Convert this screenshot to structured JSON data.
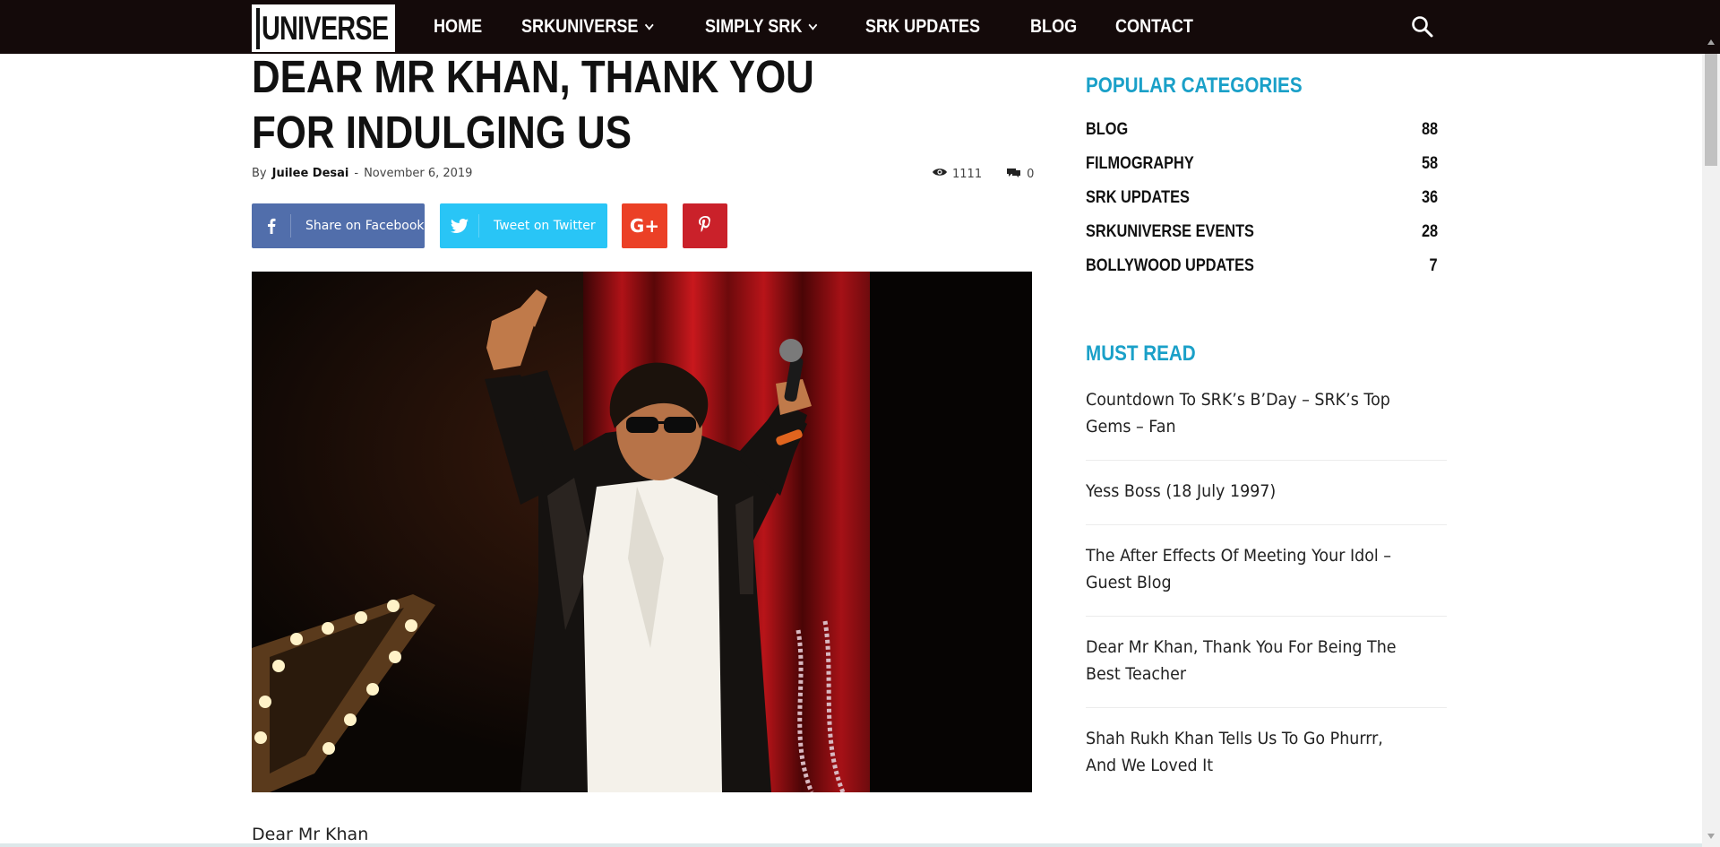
{
  "header": {
    "logo_text": "UNIVERSE",
    "nav": [
      {
        "label": "HOME",
        "dropdown": false
      },
      {
        "label": "SRKUNIVERSE",
        "dropdown": true
      },
      {
        "label": "SIMPLY SRK",
        "dropdown": true
      },
      {
        "label": "SRK UPDATES",
        "dropdown": false
      },
      {
        "label": "BLOG",
        "dropdown": false
      },
      {
        "label": "CONTACT",
        "dropdown": false
      }
    ],
    "search_icon": "search-icon",
    "background": "#140a0a"
  },
  "article": {
    "title": "DEAR MR KHAN, THANK YOU FOR INDULGING US",
    "by_label": "By",
    "author": "Juilee Desai",
    "separator": "-",
    "date": "November 6, 2019",
    "views": "1111",
    "comments": "0",
    "share": {
      "facebook_label": "Share on Facebook",
      "twitter_label": "Tweet on Twitter",
      "googleplus_label": "G+",
      "facebook_color": "#516eab",
      "twitter_color": "#29c5f6",
      "googleplus_color": "#eb4026",
      "pinterest_color": "#ca212a"
    },
    "body_start": "Dear Mr Khan"
  },
  "sidebar": {
    "popular_heading": "POPULAR CATEGORIES",
    "categories": [
      {
        "name": "BLOG",
        "count": "88"
      },
      {
        "name": "FILMOGRAPHY",
        "count": "58"
      },
      {
        "name": "SRK UPDATES",
        "count": "36"
      },
      {
        "name": "SRKUNIVERSE EVENTS",
        "count": "28"
      },
      {
        "name": "BOLLYWOOD UPDATES",
        "count": "7"
      }
    ],
    "must_read_heading": "MUST READ",
    "must_read": [
      {
        "title": "Countdown To SRK’s B’Day – SRK’s Top Gems – Fan"
      },
      {
        "title": "Yess Boss (18 July 1997)"
      },
      {
        "title": "The After Effects Of Meeting Your Idol – Guest Blog"
      },
      {
        "title": "Dear Mr Khan, Thank You For Being The Best Teacher"
      },
      {
        "title": "Shah Rukh Khan Tells Us To Go Phurrr, And We Loved It"
      }
    ],
    "accent_color": "#1aa0c8"
  }
}
